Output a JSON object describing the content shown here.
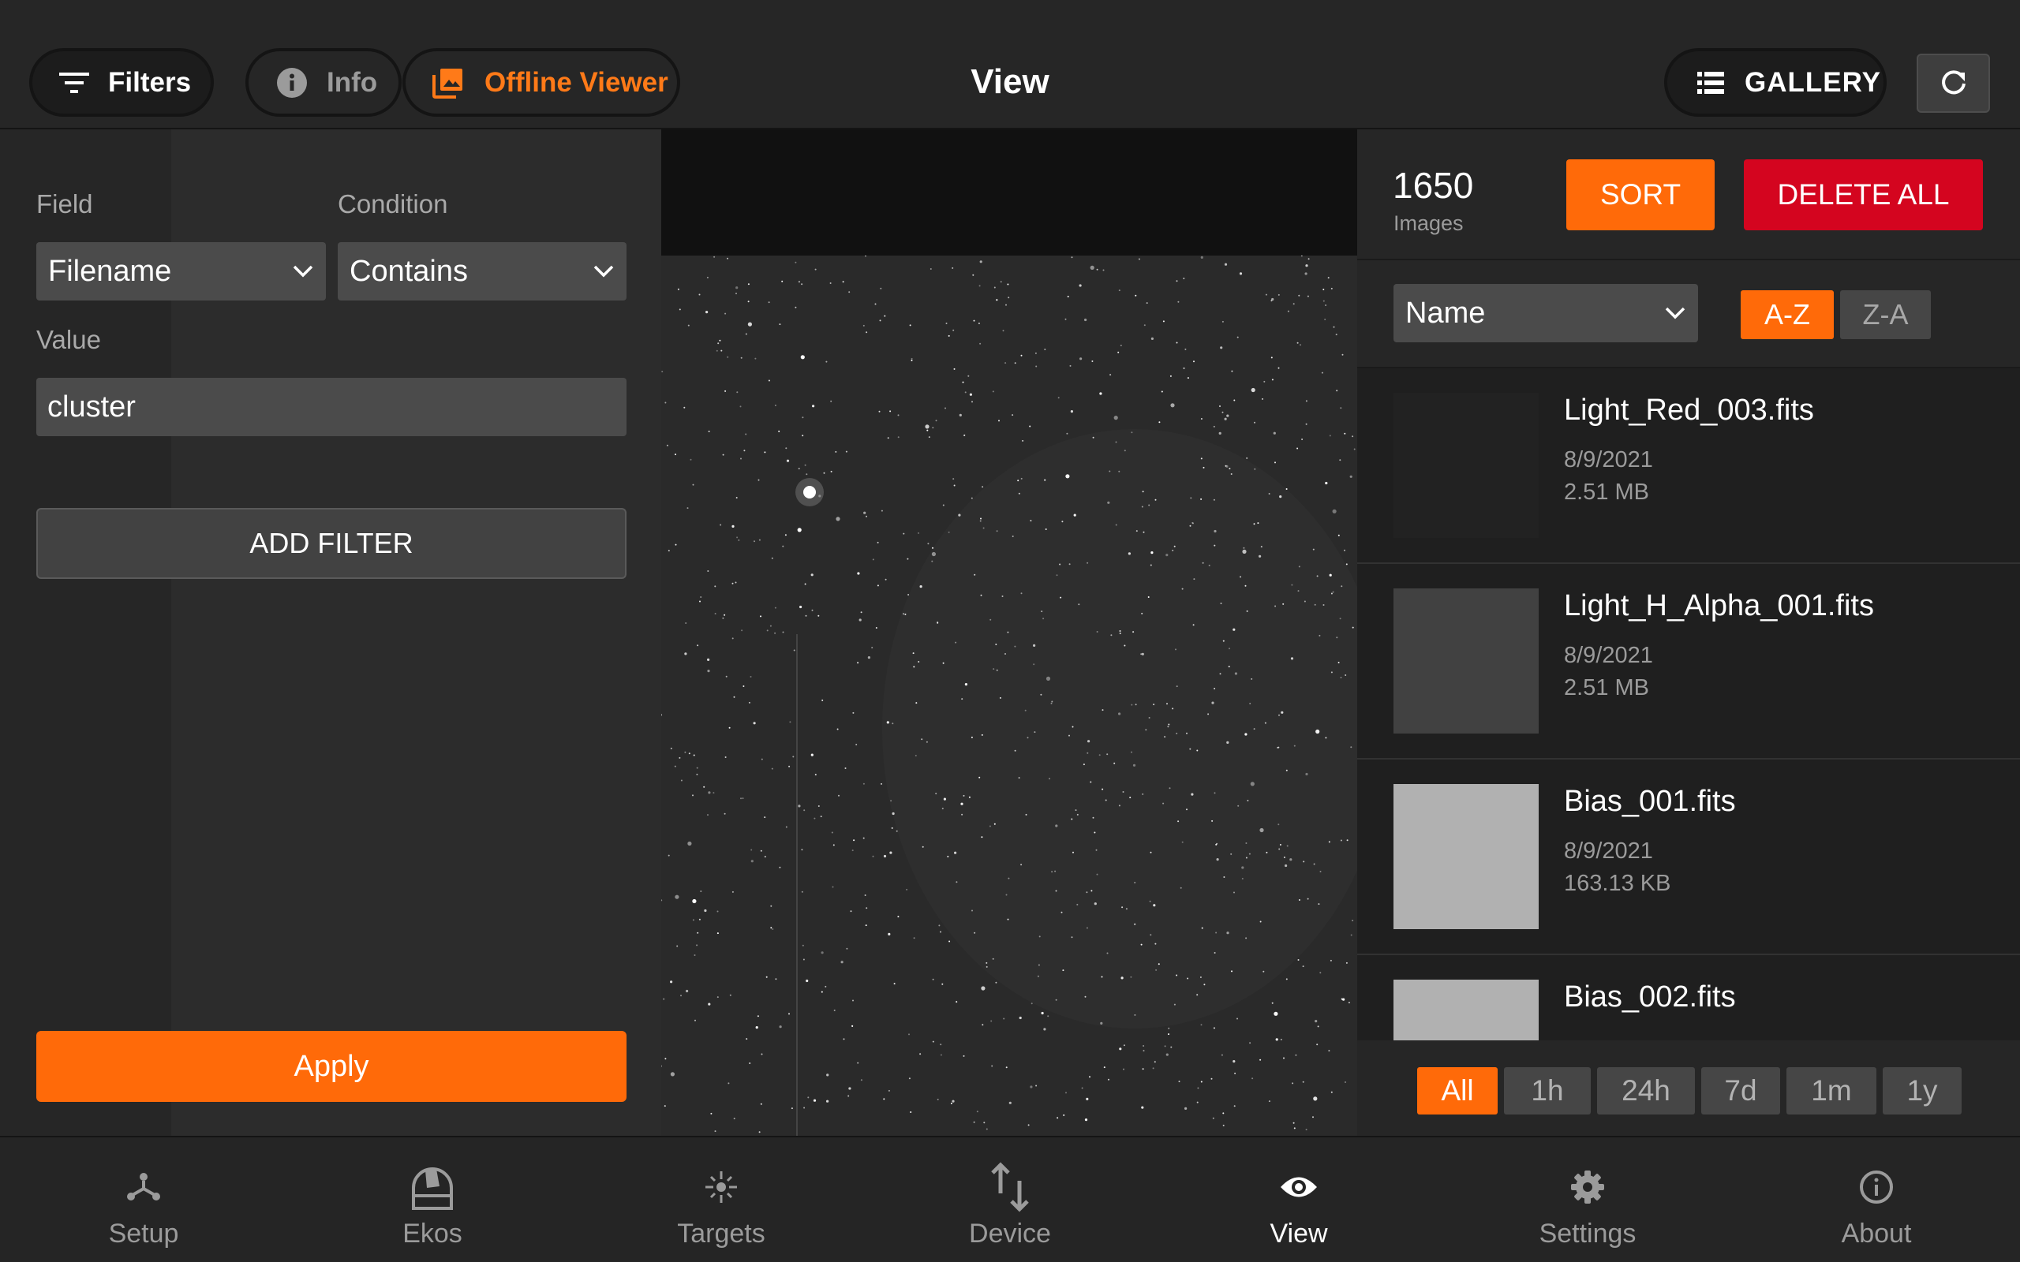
{
  "topbar": {
    "filters_label": "Filters",
    "info_label": "Info",
    "offline_label": "Offline Viewer",
    "title": "View",
    "gallery_label": "GALLERY"
  },
  "filter_panel": {
    "field_label": "Field",
    "condition_label": "Condition",
    "field_value": "Filename",
    "condition_value": "Contains",
    "value_label": "Value",
    "value_input": "cluster",
    "add_filter_label": "ADD FILTER",
    "apply_label": "Apply"
  },
  "gallery": {
    "count": "1650",
    "count_label": "Images",
    "sort_label": "SORT",
    "delete_all_label": "DELETE ALL",
    "sort_field": "Name",
    "order_asc": "A-Z",
    "order_desc": "Z-A",
    "items": [
      {
        "name": "Light_Red_003.fits",
        "date": "8/9/2021",
        "size": "2.51 MB"
      },
      {
        "name": "Light_H_Alpha_001.fits",
        "date": "8/9/2021",
        "size": "2.51 MB"
      },
      {
        "name": "Bias_001.fits",
        "date": "8/9/2021",
        "size": "163.13 KB"
      },
      {
        "name": "Bias_002.fits",
        "date": "",
        "size": ""
      }
    ],
    "time_filters": [
      "All",
      "1h",
      "24h",
      "7d",
      "1m",
      "1y"
    ],
    "active_time_filter": "All"
  },
  "nav": {
    "items": [
      {
        "label": "Setup",
        "icon": "setup-icon"
      },
      {
        "label": "Ekos",
        "icon": "observatory-dome-icon"
      },
      {
        "label": "Targets",
        "icon": "target-crosshair-icon"
      },
      {
        "label": "Device",
        "icon": "transfer-arrows-icon"
      },
      {
        "label": "View",
        "icon": "eye-icon"
      },
      {
        "label": "Settings",
        "icon": "gear-icon"
      },
      {
        "label": "About",
        "icon": "info-circle-icon"
      }
    ],
    "active": "View"
  },
  "colors": {
    "accent": "#ff6a09",
    "danger": "#d4051f",
    "background": "#262626"
  }
}
